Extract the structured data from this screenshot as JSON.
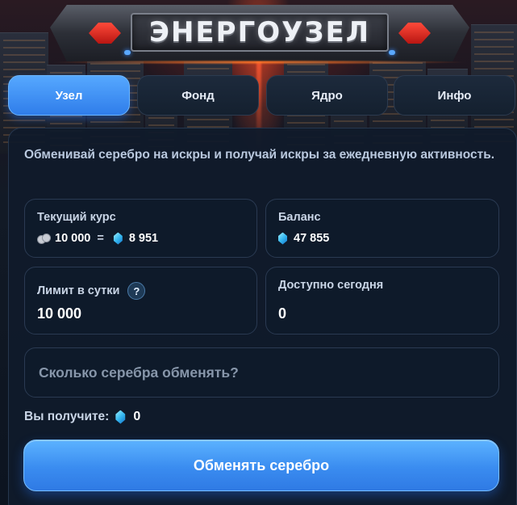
{
  "header": {
    "title": "ЭНЕРГОУЗЕЛ"
  },
  "tabs": [
    {
      "label": "Узел",
      "active": true
    },
    {
      "label": "Фонд",
      "active": false
    },
    {
      "label": "Ядро",
      "active": false
    },
    {
      "label": "Инфо",
      "active": false
    }
  ],
  "intro": "Обменивай серебро на искры и получай искры за ежедневную активность.",
  "rate": {
    "label": "Текущий курс",
    "silver": "10 000",
    "equals": "=",
    "sparks": "8 951"
  },
  "balance": {
    "label": "Баланс",
    "value": "47 855"
  },
  "limit": {
    "label": "Лимит в сутки",
    "help": "?",
    "value": "10 000"
  },
  "available": {
    "label": "Доступно сегодня",
    "value": "0"
  },
  "amount_input": {
    "placeholder": "Сколько серебра обменять?",
    "value": ""
  },
  "receive": {
    "label": "Вы получите:",
    "value": "0"
  },
  "exchange_button": {
    "label": "Обменять серебро"
  },
  "colors": {
    "accent": "#3a8cf0",
    "gem": "#ff4a3a",
    "spark": "#35b8f0"
  }
}
